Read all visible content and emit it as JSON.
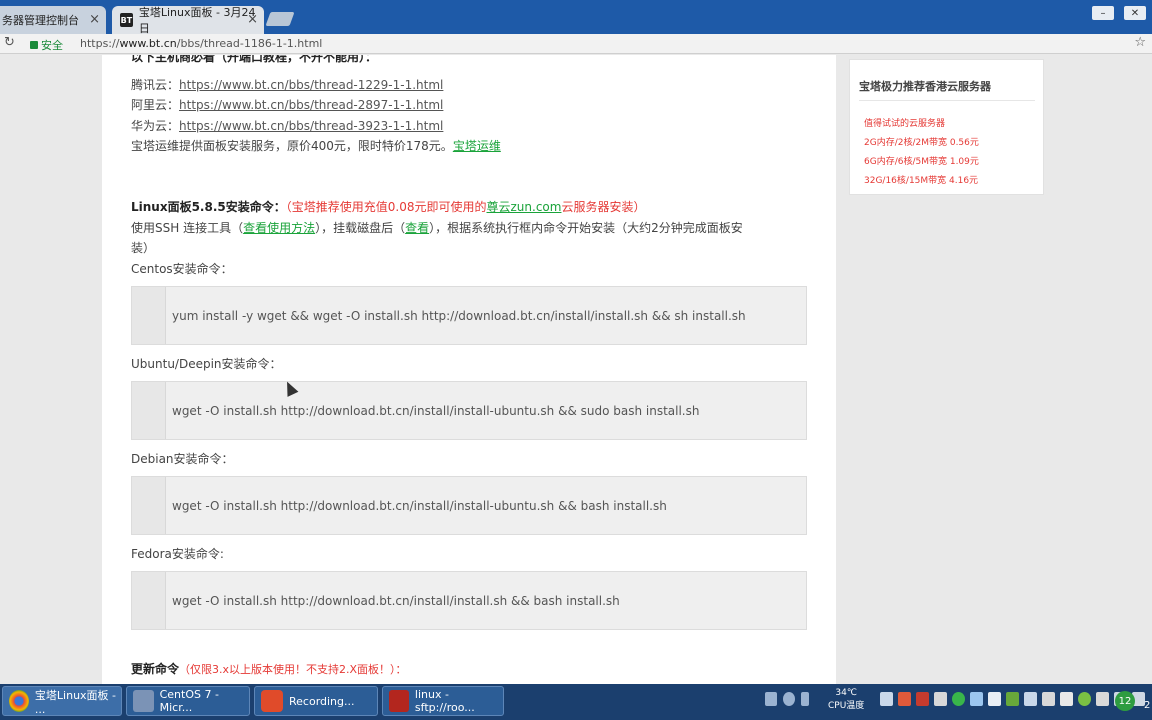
{
  "browser": {
    "tabs": [
      {
        "label": "务器管理控制台"
      },
      {
        "label": "宝塔Linux面板 - 3月24日"
      }
    ],
    "tab_badge": "BT",
    "tab_close": "×",
    "secure_label": "安全",
    "url_scheme": "https://",
    "url_host": "www.bt.cn",
    "url_path": "/bbs/thread-1186-1-1.html"
  },
  "page": {
    "cut_heading": "以下主机商必看（开端口教程，不开不能用）：",
    "cloud_lines": [
      {
        "label": "腾讯云：",
        "url": "https://www.bt.cn/bbs/thread-1229-1-1.html"
      },
      {
        "label": "阿里云：",
        "url": "https://www.bt.cn/bbs/thread-2897-1-1.html"
      },
      {
        "label": "华为云：",
        "url": "https://www.bt.cn/bbs/thread-3923-1-1.html"
      }
    ],
    "service_text": "宝塔运维提供面板安装服务，原价400元，限时特价178元。",
    "service_link": "宝塔运维",
    "install_heading": "Linux面板5.8.5安装命令：",
    "install_note_pre": "（宝塔推荐使用充值0.08元即可使用的",
    "install_note_link": "尊云zun.com",
    "install_note_post": "云服务器安装）",
    "ssh_pre": "使用SSH 连接工具（",
    "ssh_link1": "查看使用方法",
    "ssh_mid": "），挂载磁盘后（",
    "ssh_link2": "查看",
    "ssh_post": "），根据系统执行框内命令开始安装（大约2分钟完成面板安",
    "ssh_wrap": "装）",
    "sections": [
      {
        "label": "Centos安装命令：",
        "command": "yum install -y wget && wget -O install.sh http://download.bt.cn/install/install.sh && sh install.sh"
      },
      {
        "label": "Ubuntu/Deepin安装命令：",
        "command": "wget -O install.sh http://download.bt.cn/install/install-ubuntu.sh && sudo bash install.sh"
      },
      {
        "label": "Debian安装命令：",
        "command": "wget -O install.sh http://download.bt.cn/install/install-ubuntu.sh && bash install.sh"
      },
      {
        "label": "Fedora安装命令:",
        "command": "wget -O install.sh http://download.bt.cn/install/install.sh && bash install.sh"
      }
    ],
    "update_heading": "更新命令",
    "update_note": "（仅限3.x以上版本使用！不支持2.X面板！）：",
    "sidebar_title": "宝塔极力推荐香港云服务器",
    "sidebar_links": [
      "值得试试的云服务器",
      "2G内存/2核/2M带宽 0.56元",
      "6G内存/6核/5M带宽 1.09元",
      "32G/16核/15M带宽 4.16元"
    ]
  },
  "taskbar": {
    "items": [
      {
        "label": "宝塔Linux面板 - ..."
      },
      {
        "label": "CentOS 7 - Micr..."
      },
      {
        "label": "Recording..."
      },
      {
        "label": "linux - sftp://roo..."
      }
    ],
    "temp": "34℃",
    "temp_label": "CPU温度",
    "badge": "12",
    "edge": "2"
  },
  "colors": {
    "accent_red": "#e53935",
    "accent_green": "#1aa33a",
    "taskbar": "#1b3f6e"
  }
}
